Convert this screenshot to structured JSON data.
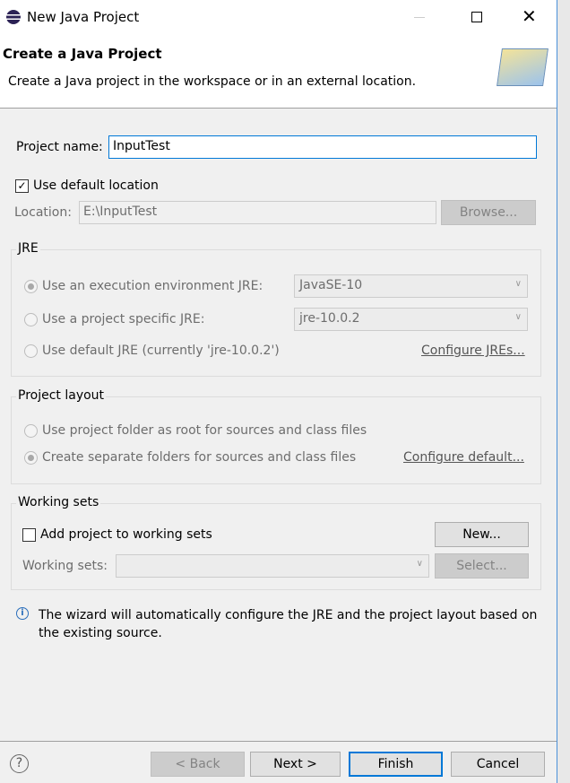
{
  "window": {
    "title": "New Java Project"
  },
  "header": {
    "title": "Create a Java Project",
    "description": "Create a Java project in the workspace or in an external location."
  },
  "project_name": {
    "label": "Project name:",
    "value": "InputTest"
  },
  "default_location": {
    "label": "Use default location",
    "checked": true
  },
  "location": {
    "label": "Location:",
    "value": "E:\\InputTest",
    "browse": "Browse..."
  },
  "jre": {
    "title": "JRE",
    "exec_env": {
      "label": "Use an execution environment JRE:",
      "value": "JavaSE-10"
    },
    "specific": {
      "label": "Use a project specific JRE:",
      "value": "jre-10.0.2"
    },
    "default": {
      "label": "Use default JRE (currently 'jre-10.0.2')"
    },
    "configure": "Configure JREs..."
  },
  "layout": {
    "title": "Project layout",
    "root": "Use project folder as root for sources and class files",
    "separate": "Create separate folders for sources and class files",
    "configure": "Configure default..."
  },
  "working_sets": {
    "title": "Working sets",
    "add": "Add project to working sets",
    "new": "New...",
    "label": "Working sets:",
    "select": "Select..."
  },
  "info": "The wizard will automatically configure the JRE and the project layout based on the existing source.",
  "footer": {
    "back": "< Back",
    "next": "Next >",
    "finish": "Finish",
    "cancel": "Cancel"
  }
}
